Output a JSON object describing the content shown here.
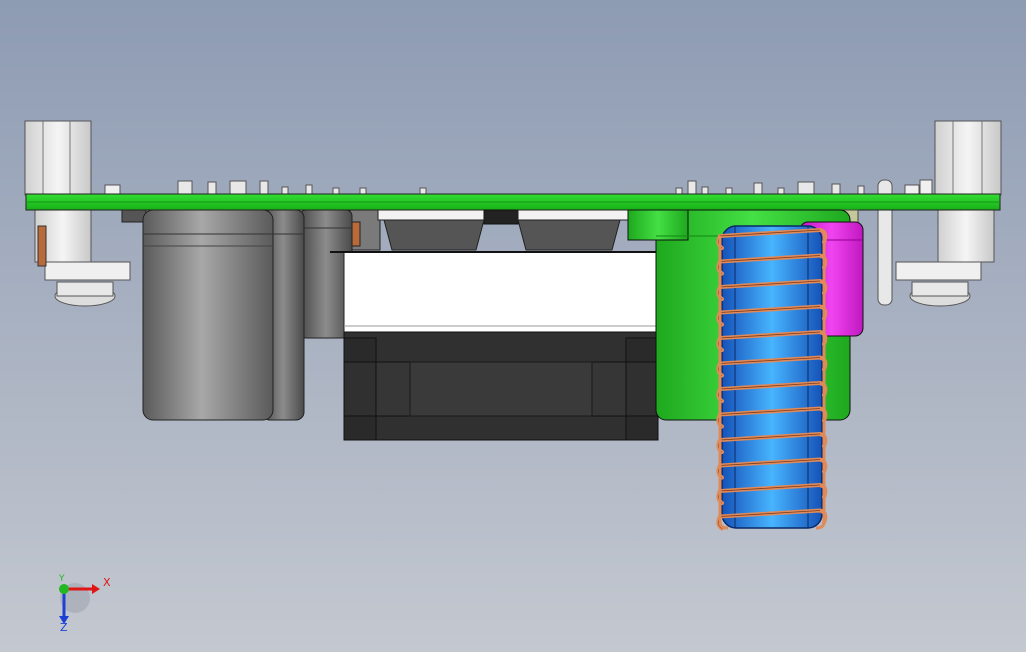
{
  "viewport": {
    "background_top": "#8d9bb3",
    "background_bottom": "#c4c8d0"
  },
  "triad": {
    "x_label": "X",
    "y_label": "Y",
    "z_label": "Z",
    "x_color": "#e01515",
    "y_color": "#22b822",
    "z_color": "#1e3fd6"
  },
  "parts": {
    "pcb_color": "#22cc22",
    "capacitor_color": "#6e6e6e",
    "green_capacitor_color": "#22c622",
    "magenta_capacitor_color": "#e22ae2",
    "fan_color": "#2f2f2f",
    "heatsink_color": "#ffffff",
    "toroid_color": "#2a7be0",
    "copper_wire_color": "#e08a5a",
    "bracket_color": "#ededed"
  }
}
